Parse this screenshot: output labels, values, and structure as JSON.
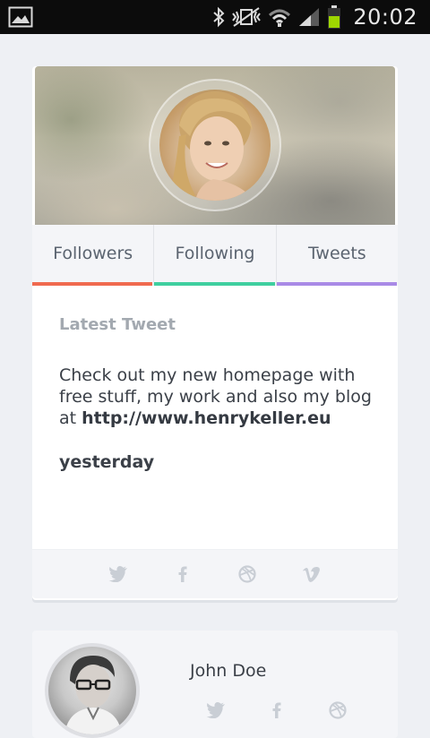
{
  "status_bar": {
    "time": "20:02",
    "icons": [
      "gallery-icon",
      "bluetooth-icon",
      "vibrate-icon",
      "wifi-icon",
      "signal-icon",
      "battery-icon"
    ],
    "battery_color": "#9ed600"
  },
  "profile": {
    "tabs": [
      {
        "label": "Followers",
        "color": "#f06a4f"
      },
      {
        "label": "Following",
        "color": "#3fcf9f"
      },
      {
        "label": "Tweets",
        "color": "#a98ae6"
      }
    ],
    "latest_tweet": {
      "heading": "Latest Tweet",
      "text": "Check out my new homepage with free stuff, my work and also my blog at ",
      "link": "http://www.henrykeller.eu",
      "time": "yesterday"
    },
    "social_icons": [
      "twitter-icon",
      "facebook-icon",
      "dribbble-icon",
      "vimeo-icon"
    ]
  },
  "second_profile": {
    "name": "John Doe",
    "social_icons": [
      "twitter-icon",
      "facebook-icon",
      "dribbble-icon"
    ]
  }
}
